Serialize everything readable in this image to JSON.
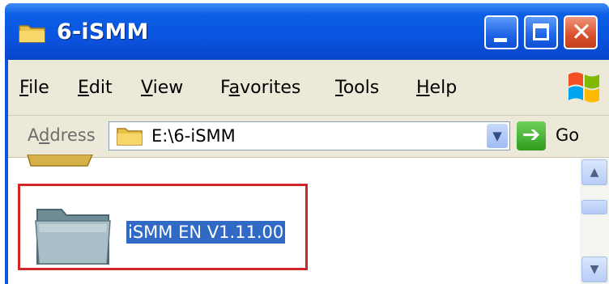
{
  "window": {
    "title": "6-iSMM",
    "controls": {
      "minimize": "minimize",
      "maximize": "maximize",
      "close": "✕"
    }
  },
  "menu": [
    {
      "pre": "",
      "u": "F",
      "post": "ile"
    },
    {
      "pre": "",
      "u": "E",
      "post": "dit"
    },
    {
      "pre": "",
      "u": "V",
      "post": "iew"
    },
    {
      "pre": "F",
      "u": "a",
      "post": "vorites"
    },
    {
      "pre": "",
      "u": "T",
      "post": "ools"
    },
    {
      "pre": "",
      "u": "H",
      "post": "elp"
    }
  ],
  "address": {
    "label_pre": "A",
    "label_u": "d",
    "label_post": "dress",
    "path": "E:\\6-iSMM",
    "go_label": "Go"
  },
  "content": {
    "selected_folder_name": "iSMM EN V1.11.00"
  },
  "icons": {
    "title": "folder-icon",
    "address": "folder-icon",
    "go": "go-arrow-icon",
    "logo": "windows-logo-icon",
    "item": "folder-icon"
  },
  "colors": {
    "title_bar": "#0a54e0",
    "close_button": "#d9512c",
    "selection": "#316ac5",
    "highlight_border": "#d0282a",
    "menu_bg": "#ece9d8"
  }
}
